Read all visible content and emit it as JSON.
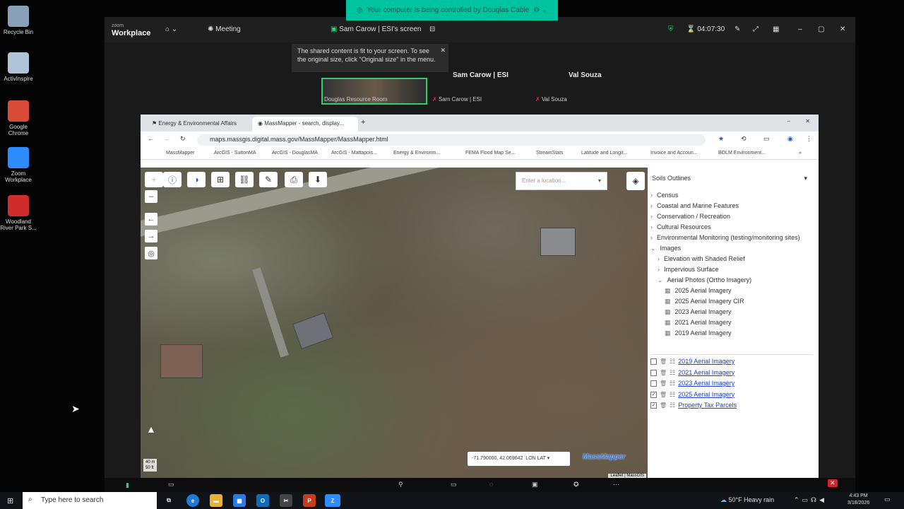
{
  "desktop": {
    "icons": [
      {
        "name": "recycle-bin-icon",
        "label": "Recycle Bin",
        "color": "#8aa0b8"
      },
      {
        "name": "activinspire-icon",
        "label": "ActivInspire",
        "color": "#b0c4d8"
      },
      {
        "name": "google-chrome-icon",
        "label": "Google Chrome",
        "color": "#d94a38"
      },
      {
        "name": "zoom-workplace-icon",
        "label": "Zoom Workplace",
        "color": "#2d8cff"
      },
      {
        "name": "pdf-icon",
        "label": "Woodland River Park S...",
        "color": "#d12c2c"
      }
    ]
  },
  "zoom": {
    "banner": "Your computer is being controlled by Douglas Cable",
    "brand_small": "zoom",
    "brand": "Workplace",
    "meeting_label": "Meeting",
    "share_label": "Sam Carow | ESI's screen",
    "timer": "04:07:30",
    "tooltip": "The shared content is fit to your screen. To see the original size, click \"Original size\" in the menu.",
    "participants": [
      {
        "name": "Sam Carow | ESI"
      },
      {
        "name": "Val Souza"
      }
    ],
    "thumb_labels": [
      "Douglas Resource Room",
      "Sam Carow | ESI",
      "Val Souza"
    ]
  },
  "browser": {
    "tabs": [
      "Energy & Environmental Affairs",
      "MassMapper - search, display..."
    ],
    "url": "maps.massgis.digital.mass.gov/MassMapper/MassMapper.html",
    "bookmarks": [
      "MassMapper",
      "ArcGIS - SuttonMA",
      "ArcGIS - DouglasMA",
      "ArcGIS - Mattapois...",
      "Energy & Environm...",
      "FEMA Flood Map Se...",
      "StreamStats",
      "Latitude and Longit...",
      "Invoice and Accoun...",
      "BOLM Environment..."
    ]
  },
  "map": {
    "search_placeholder": "Enter a location...",
    "coords": "-71.790000, 42.069642",
    "coord_mode": "LON LAT",
    "logo": "MassMapper",
    "scale_labels": [
      "40 m",
      "50 ft"
    ],
    "attribution": "Leaflet | MassGIS"
  },
  "panel": {
    "selected": "Soils Outlines",
    "tree": [
      {
        "label": "Census",
        "indent": 0,
        "arrow": "›"
      },
      {
        "label": "Coastal and Marine Features",
        "indent": 0,
        "arrow": "›"
      },
      {
        "label": "Conservation / Recreation",
        "indent": 0,
        "arrow": "›"
      },
      {
        "label": "Cultural Resources",
        "indent": 0,
        "arrow": "›"
      },
      {
        "label": "Environmental Monitoring (testing/monitoring sites)",
        "indent": 0,
        "arrow": "›"
      },
      {
        "label": "Images",
        "indent": 0,
        "arrow": "⌄"
      },
      {
        "label": "Elevation with Shaded Relief",
        "indent": 1,
        "arrow": "›"
      },
      {
        "label": "Impervious Surface",
        "indent": 1,
        "arrow": "›"
      },
      {
        "label": "Aerial Photos (Ortho Imagery)",
        "indent": 1,
        "arrow": "⌄"
      },
      {
        "label": "2025 Aerial Imagery",
        "indent": 2,
        "arrow": "▦"
      },
      {
        "label": "2025 Aerial Imagery CIR",
        "indent": 2,
        "arrow": "▦"
      },
      {
        "label": "2023 Aerial Imagery",
        "indent": 2,
        "arrow": "▦"
      },
      {
        "label": "2021 Aerial Imagery",
        "indent": 2,
        "arrow": "▦"
      },
      {
        "label": "2019 Aerial Imagery",
        "indent": 2,
        "arrow": "▦"
      }
    ],
    "layers": [
      {
        "label": "2019 Aerial Imagery",
        "checked": false
      },
      {
        "label": "2021 Aerial Imagery",
        "checked": false
      },
      {
        "label": "2023 Aerial Imagery",
        "checked": false
      },
      {
        "label": "2025 Aerial Imagery",
        "checked": true
      },
      {
        "label": "Property Tax Parcels",
        "checked": true
      }
    ]
  },
  "taskbar": {
    "search_placeholder": "Type here to search",
    "weather": "50°F Heavy rain",
    "time": "4:43 PM",
    "date": "3/18/2026"
  }
}
